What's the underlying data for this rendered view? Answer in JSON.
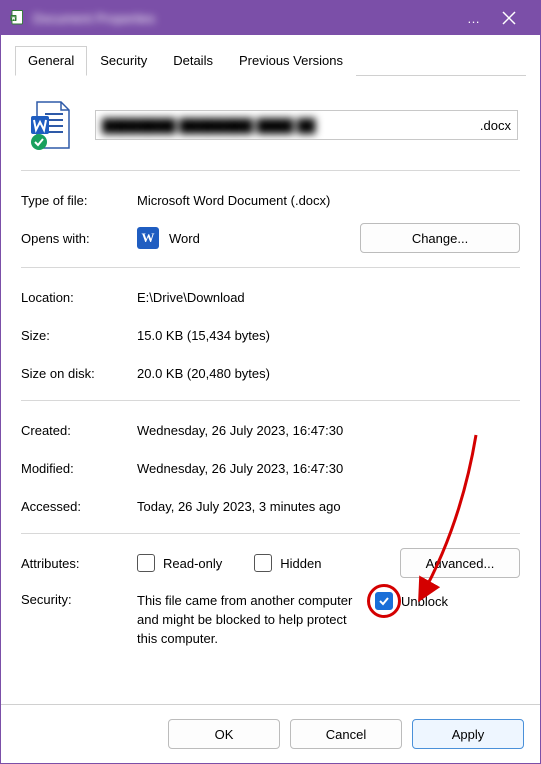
{
  "titlebar": {
    "title": "Document Properties"
  },
  "tabs": {
    "general": "General",
    "security": "Security",
    "details": "Details",
    "previous": "Previous Versions"
  },
  "file": {
    "name_obscured": "████████ ████████ ████ ██",
    "ext": ".docx"
  },
  "labels": {
    "type": "Type of file:",
    "opens": "Opens with:",
    "location": "Location:",
    "size": "Size:",
    "sizeondisk": "Size on disk:",
    "created": "Created:",
    "modified": "Modified:",
    "accessed": "Accessed:",
    "attributes": "Attributes:",
    "security": "Security:"
  },
  "values": {
    "type": "Microsoft Word Document (.docx)",
    "opens_app": "Word",
    "location": "E:\\Drive\\Download",
    "size": "15.0 KB (15,434 bytes)",
    "sizeondisk": "20.0 KB (20,480 bytes)",
    "created": "Wednesday, 26 July 2023, 16:47:30",
    "modified": "Wednesday, 26 July 2023, 16:47:30",
    "accessed": "Today, 26 July 2023, 3 minutes ago",
    "security_text": "This file came from another computer and might be blocked to help protect this computer."
  },
  "buttons": {
    "change": "Change...",
    "advanced": "Advanced...",
    "ok": "OK",
    "cancel": "Cancel",
    "apply": "Apply"
  },
  "checkboxes": {
    "readonly": "Read-only",
    "hidden": "Hidden",
    "unblock": "Unblock"
  }
}
